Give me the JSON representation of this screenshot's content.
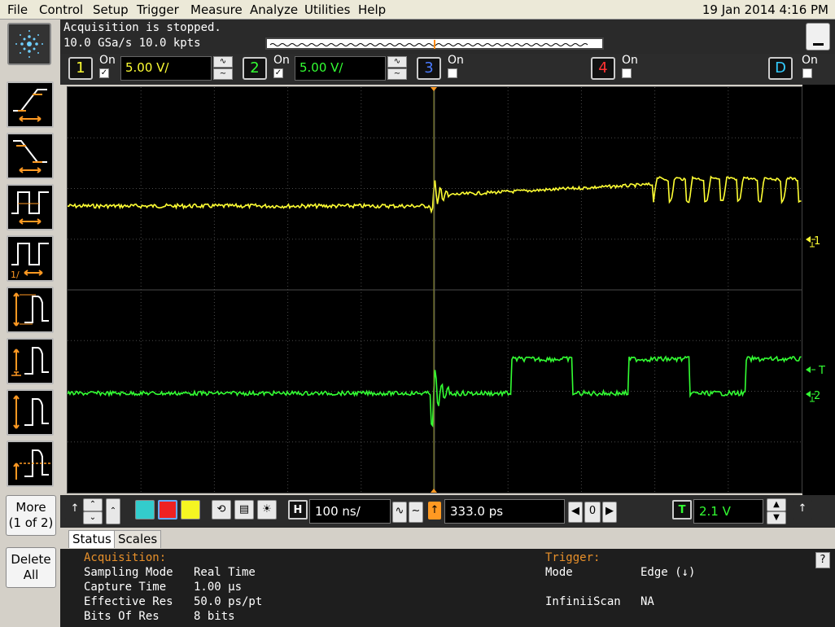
{
  "menu": [
    "File",
    "Control",
    "Setup",
    "Trigger",
    "Measure",
    "Analyze",
    "Utilities",
    "Help"
  ],
  "datetime": "19 Jan 2014  4:16 PM",
  "acquisition_banner": {
    "line1": "Acquisition is stopped.",
    "line2": "10.0 GSa/s   10.0 kpts"
  },
  "channels": [
    {
      "num": "1",
      "on_label": "On",
      "checked": true,
      "scale": "5.00 V/",
      "color": "#ffff33"
    },
    {
      "num": "2",
      "on_label": "On",
      "checked": true,
      "scale": "5.00 V/",
      "color": "#33ff33"
    },
    {
      "num": "3",
      "on_label": "On",
      "checked": false,
      "color": "#4a7bff"
    },
    {
      "num": "4",
      "on_label": "On",
      "checked": false,
      "color": "#ff3333"
    },
    {
      "num": "D",
      "on_label": "On",
      "checked": false,
      "color": "#33ccff"
    }
  ],
  "sidebar": {
    "more": "More",
    "more_page": "(1 of 2)",
    "delete": "Delete",
    "delete2": "All"
  },
  "markers": {
    "ch1": "1",
    "ch2": "2",
    "trigger": "T"
  },
  "horizontal": {
    "badge": "H",
    "scale": "100 ns/",
    "position": "333.0 ps",
    "ref_value": "0"
  },
  "trigger_ctl": {
    "badge": "T",
    "level": "2.1 V"
  },
  "tabs": [
    "Status",
    "Scales"
  ],
  "status_panel": {
    "left_header": "Acquisition:",
    "left_rows": [
      {
        "k": "Sampling Mode",
        "v": "Real Time"
      },
      {
        "k": "Capture Time",
        "v": "1.00 µs"
      },
      {
        "k": "Effective Res",
        "v": "50.0 ps/pt"
      },
      {
        "k": "Bits Of Res",
        "v": "8 bits"
      }
    ],
    "right_header": "Trigger:",
    "right_rows": [
      {
        "k": "Mode",
        "v": "Edge (↓)"
      },
      {
        "k": "",
        "v": ""
      },
      {
        "k": "InfiniiScan",
        "v": "NA"
      }
    ],
    "help": "?"
  },
  "colors": {
    "ch1": "#ffff33",
    "ch2": "#33ff33",
    "trigger": "#ff9922",
    "grid": "#4a4a4a"
  }
}
